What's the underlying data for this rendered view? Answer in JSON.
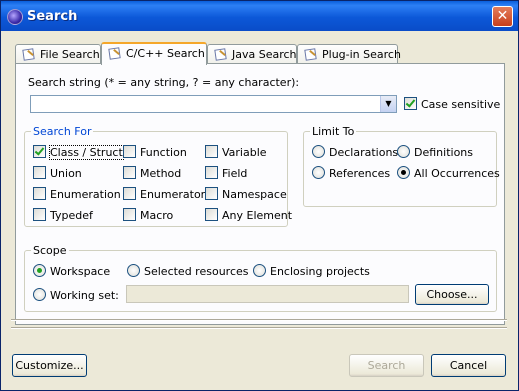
{
  "window": {
    "title": "Search",
    "close_label": "✕"
  },
  "tabs": [
    {
      "label": "File Search",
      "active": false
    },
    {
      "label": "C/C++ Search",
      "active": true
    },
    {
      "label": "Java Search",
      "active": false
    },
    {
      "label": "Plug-in Search",
      "active": false
    }
  ],
  "search_string": {
    "label": "Search string (* = any string, ? = any character):",
    "value": "",
    "case_sensitive_label": "Case sensitive",
    "case_sensitive": true
  },
  "search_for": {
    "title": "Search For",
    "items": [
      {
        "label": "Class / Struct",
        "checked": true
      },
      {
        "label": "Function",
        "checked": false
      },
      {
        "label": "Variable",
        "checked": false
      },
      {
        "label": "Union",
        "checked": false
      },
      {
        "label": "Method",
        "checked": false
      },
      {
        "label": "Field",
        "checked": false
      },
      {
        "label": "Enumeration",
        "checked": false
      },
      {
        "label": "Enumerator",
        "checked": false
      },
      {
        "label": "Namespace",
        "checked": false
      },
      {
        "label": "Typedef",
        "checked": false
      },
      {
        "label": "Macro",
        "checked": false
      },
      {
        "label": "Any Element",
        "checked": false
      }
    ]
  },
  "limit_to": {
    "title": "Limit To",
    "options": [
      {
        "label": "Declarations",
        "selected": false
      },
      {
        "label": "Definitions",
        "selected": false
      },
      {
        "label": "References",
        "selected": false
      },
      {
        "label": "All Occurrences",
        "selected": true
      }
    ]
  },
  "scope": {
    "title": "Scope",
    "options": [
      {
        "label": "Workspace",
        "selected": true
      },
      {
        "label": "Selected resources",
        "selected": false
      },
      {
        "label": "Enclosing projects",
        "selected": false
      },
      {
        "label": "Working set:",
        "selected": false
      }
    ],
    "working_set_value": "",
    "choose_label": "Choose..."
  },
  "buttons": {
    "customize": "Customize...",
    "search": "Search",
    "cancel": "Cancel"
  },
  "colors": {
    "titlebar": "#0a5fdc",
    "dialog_bg": "#ece9d8",
    "group_title": "#0046d5",
    "check": "#21a121"
  }
}
